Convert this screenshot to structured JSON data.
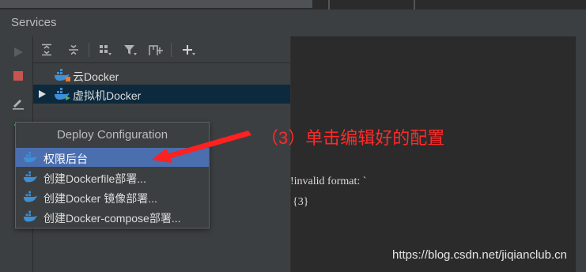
{
  "panel": {
    "title": "Services"
  },
  "toolbar": {
    "buttons": [
      {
        "icon": "expand-all-icon"
      },
      {
        "icon": "collapse-all-icon"
      },
      {
        "icon": "group-by-icon"
      },
      {
        "icon": "filter-icon"
      },
      {
        "icon": "new-tab-icon"
      },
      {
        "icon": "add-icon"
      }
    ]
  },
  "left_actions": [
    "run-icon",
    "stop-icon",
    "edit-icon"
  ],
  "tree": {
    "items": [
      {
        "label": "云Docker",
        "icon": "docker-icon"
      },
      {
        "label": "虚拟机Docker",
        "icon": "docker-icon",
        "selected": true,
        "expandable": true
      }
    ]
  },
  "popup": {
    "title": "Deploy Configuration",
    "items": [
      {
        "label": "权限后台",
        "icon": "docker-icon",
        "selected": true
      },
      {
        "label": "创建Dockerfile部署...",
        "icon": "docker-icon"
      },
      {
        "label": "创建Docker 镜像部署...",
        "icon": "docker-icon"
      },
      {
        "label": "创建Docker-compose部署...",
        "icon": "docker-icon"
      }
    ]
  },
  "console": {
    "line1": "!invalid format: `",
    "line2": "{3}"
  },
  "annotation": {
    "text": "（3）单击编辑好的配置",
    "color": "#ff2a2a"
  },
  "watermark": {
    "text": "https://blog.csdn.net/jiqianclub.cn"
  },
  "colors": {
    "selection_tree": "#0d293e",
    "selection_popup": "#4b6eaf",
    "docker_blue": "#3d8fd6",
    "stop_red": "#c75450"
  }
}
